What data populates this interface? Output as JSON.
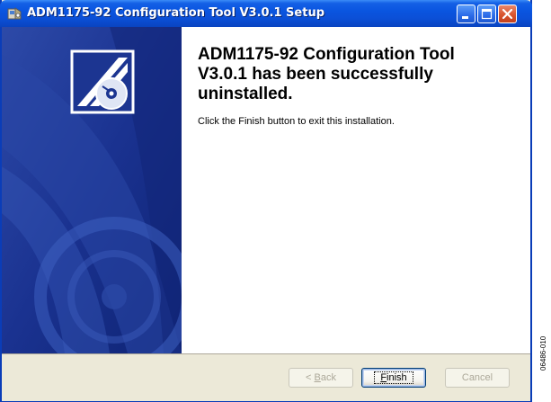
{
  "window": {
    "title": "ADM1175-92 Configuration Tool V3.0.1 Setup",
    "controls": [
      "minimize",
      "maximize",
      "close"
    ]
  },
  "content": {
    "heading_lines": [
      "ADM1175-92 Configuration Tool",
      "V3.0.1 has been successfully",
      "uninstalled."
    ],
    "message": "Click the Finish button to exit this installation."
  },
  "buttons": {
    "back": {
      "prefix": "< ",
      "mnemonic": "B",
      "rest": "ack",
      "enabled": false
    },
    "finish": {
      "mnemonic": "F",
      "rest": "inish",
      "enabled": true,
      "focused": true
    },
    "cancel": {
      "label": "Cancel",
      "enabled": false
    }
  },
  "figure_label": "06486-010",
  "colors": {
    "titlebar": "#0b4fd6",
    "sidebar": "#1c3591",
    "dialog_bg": "#ece9d8",
    "close_button": "#d8542e"
  },
  "icons": {
    "title": "setup-package-icon",
    "sidebar": "installer-cd-icon"
  }
}
